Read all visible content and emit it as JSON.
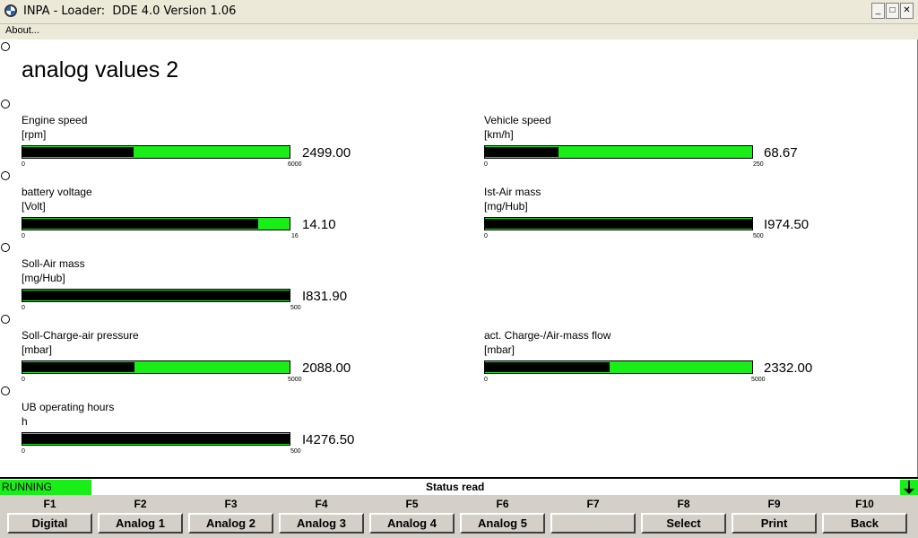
{
  "window": {
    "title": "INPA - Loader:  DDE 4.0 Version 1.06"
  },
  "menu": {
    "about": "About..."
  },
  "page": {
    "title": "analog values 2"
  },
  "gauges": [
    {
      "label": "Engine speed",
      "unit": "[rpm]",
      "min": "0",
      "max": "6000",
      "value": "2499.00",
      "fill": 0.416
    },
    {
      "label": "Vehicle speed",
      "unit": "[km/h]",
      "min": "0",
      "max": "250",
      "value": "68.67",
      "fill": 0.275
    },
    {
      "label": "battery voltage",
      "unit": "[Volt]",
      "min": "0",
      "max": "16",
      "value": "14.10",
      "fill": 0.881
    },
    {
      "label": "Ist-Air mass",
      "unit": "[mg/Hub]",
      "min": "0",
      "max": "500",
      "value": "I974.50",
      "fill": 1.0
    },
    {
      "label": "Soll-Air mass",
      "unit": "[mg/Hub]",
      "min": "0",
      "max": "500",
      "value": "I831.90",
      "fill": 1.0
    },
    {
      "label": "Soll-Charge-air pressure",
      "unit": "[mbar]",
      "min": "0",
      "max": "5000",
      "value": "2088.00",
      "fill": 0.418
    },
    {
      "label": "act. Charge-/Air-mass flow",
      "unit": "[mbar]",
      "min": "0",
      "max": "5000",
      "value": "2332.00",
      "fill": 0.466
    },
    {
      "label": "UB operating hours",
      "unit": "h",
      "min": "0",
      "max": "500",
      "value": "I4276.50",
      "fill": 1.0
    }
  ],
  "status": {
    "state": "RUNNING",
    "text": "Status read"
  },
  "fkeys": [
    {
      "key": "F1",
      "label": "Digital"
    },
    {
      "key": "F2",
      "label": "Analog 1"
    },
    {
      "key": "F3",
      "label": "Analog 2"
    },
    {
      "key": "F4",
      "label": "Analog 3"
    },
    {
      "key": "F5",
      "label": "Analog 4"
    },
    {
      "key": "F6",
      "label": "Analog 5"
    },
    {
      "key": "F7",
      "label": ""
    },
    {
      "key": "F8",
      "label": "Select"
    },
    {
      "key": "F9",
      "label": "Print"
    },
    {
      "key": "F10",
      "label": "Back"
    }
  ],
  "colors": {
    "bar_green": "#19ee19",
    "bar_fill": "#000000",
    "running_green": "#19ee19"
  }
}
